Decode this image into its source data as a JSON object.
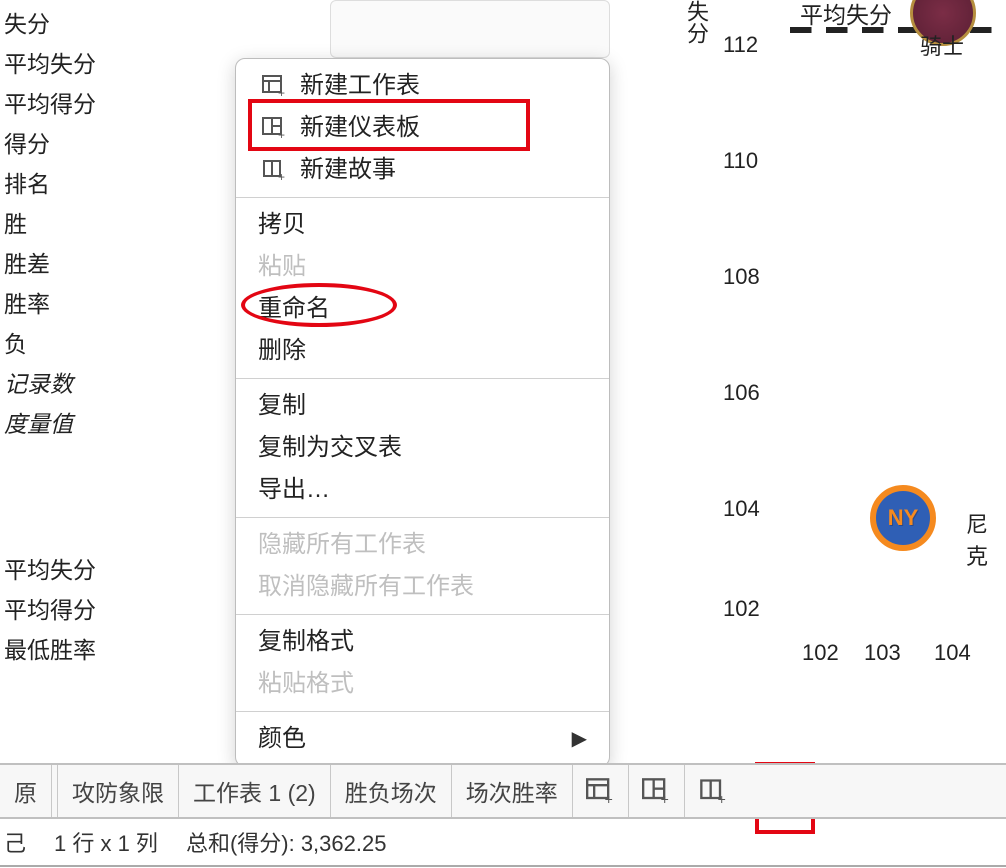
{
  "fields_group1": [
    "失分",
    "平均失分",
    "平均得分",
    "得分",
    "排名",
    "胜",
    "胜差",
    "胜率",
    "负",
    "记录数",
    "度量值"
  ],
  "fields_group2": [
    "平均失分",
    "平均得分",
    "最低胜率"
  ],
  "menu": {
    "new_sheet": "新建工作表",
    "new_dashboard": "新建仪表板",
    "new_story": "新建故事",
    "copy": "拷贝",
    "paste": "粘贴",
    "rename": "重命名",
    "delete": "删除",
    "duplicate": "复制",
    "dup_crosstab": "复制为交叉表",
    "export": "导出…",
    "hide_all": "隐藏所有工作表",
    "unhide_all": "取消隐藏所有工作表",
    "copy_format": "复制格式",
    "paste_format": "粘贴格式",
    "color": "颜色"
  },
  "chart": {
    "legend_top": "平均失分",
    "y_label": "失分",
    "y_ticks": [
      "112",
      "110",
      "108",
      "106",
      "104",
      "102"
    ],
    "x_ticks": [
      "102",
      "103",
      "104"
    ],
    "team1_short": "骑士",
    "team2_short": "尼克",
    "ny_text": "NY"
  },
  "chart_data": {
    "type": "scatter",
    "xlabel": "",
    "ylabel": "失分",
    "ylim": [
      102,
      112
    ],
    "xlim": [
      102,
      104
    ],
    "reference_lines": [
      {
        "label": "平均失分",
        "axis": "y",
        "value": 112
      }
    ],
    "series": [
      {
        "name": "骑士",
        "x": 104.3,
        "y": 112.2
      },
      {
        "name": "尼克",
        "x": 103.5,
        "y": 103.7
      }
    ]
  },
  "tabs": {
    "source": "原",
    "t1": "攻防象限",
    "t2": "工作表 1 (2)",
    "t3": "胜负场次",
    "t4": "场次胜率"
  },
  "status": {
    "s1": "己",
    "s2": "1 行 x 1 列",
    "s3": "总和(得分): 3,362.25"
  }
}
